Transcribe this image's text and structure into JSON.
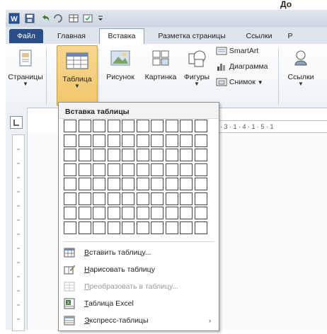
{
  "caption": "До",
  "title_bar": {
    "qat": [
      "word-icon",
      "save-icon",
      "undo-icon",
      "redo-icon",
      "table-icon",
      "customize-icon"
    ]
  },
  "tabs": [
    {
      "label": "Файл",
      "state": "file"
    },
    {
      "label": "Главная",
      "state": "normal"
    },
    {
      "label": "Вставка",
      "state": "active"
    },
    {
      "label": "Разметка страницы",
      "state": "normal"
    },
    {
      "label": "Ссылки",
      "state": "normal"
    },
    {
      "label": "Р",
      "state": "normal"
    }
  ],
  "ribbon": {
    "pages": "Страницы",
    "table": "Таблица",
    "picture": "Рисунок",
    "clipart": "Картинка",
    "shapes": "Фигуры",
    "smartart": "SmartArt",
    "chart": "Диаграмма",
    "screenshot": "Снимок",
    "links": "Ссылки"
  },
  "ruler": {
    "marks": "· 1 · 3 · 1 · 4 · 1 · 5 · 1"
  },
  "dropdown": {
    "title": "Вставка таблицы",
    "grid": {
      "columns": 10,
      "rows": 8
    },
    "items": [
      {
        "prefix": "",
        "u": "В",
        "rest": "ставить таблицу...",
        "icon": "insert-table-icon",
        "disabled": false
      },
      {
        "prefix": "",
        "u": "Н",
        "rest": "арисовать таблицу",
        "icon": "draw-table-icon",
        "disabled": false
      },
      {
        "prefix": "",
        "u": "П",
        "rest": "реобразовать в таблицу...",
        "icon": "convert-table-icon",
        "disabled": true
      },
      {
        "prefix": "",
        "u": "Т",
        "rest": "аблица Excel",
        "icon": "excel-table-icon",
        "disabled": false
      },
      {
        "prefix": "",
        "u": "Э",
        "rest": "кспресс-таблицы",
        "icon": "quick-tables-icon",
        "disabled": false,
        "submenu": true
      }
    ]
  },
  "colors": {
    "file_tab": "#2a4e87",
    "ribbon_bg": "#eef2f6",
    "accent": "#8da0b4"
  }
}
